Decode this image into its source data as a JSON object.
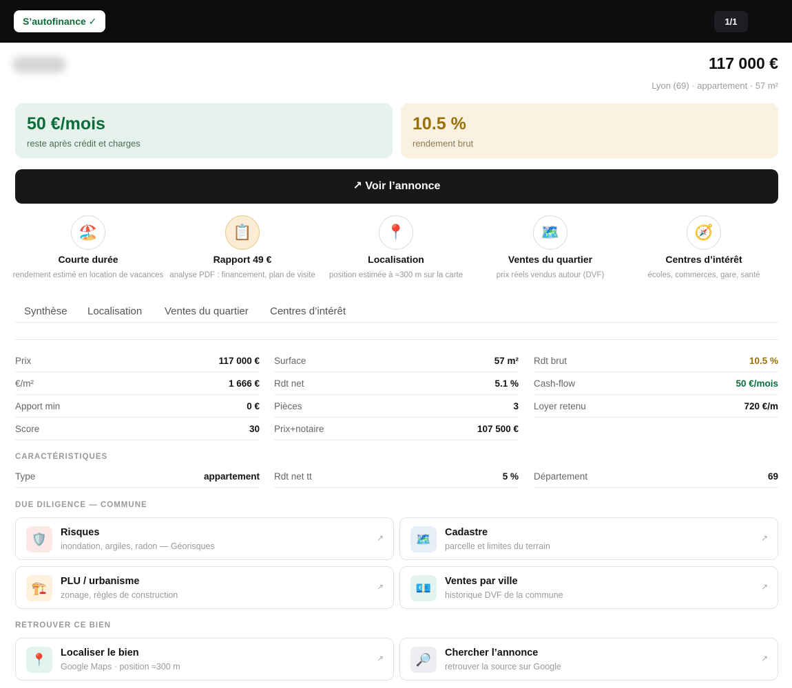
{
  "topbar": {
    "badge": "S’autofinance ✓",
    "counter": "1/1"
  },
  "header": {
    "price": "117 000 €",
    "location": "Lyon (69) · appartement · 57 m²"
  },
  "kpis": {
    "cashflow": {
      "value": "50 €/mois",
      "label": "reste après crédit et charges"
    },
    "yield": {
      "value": "10.5 %",
      "label": "rendement brut"
    }
  },
  "cta": {
    "label": "↗ Voir l’annonce"
  },
  "features": [
    {
      "icon": "🏖️",
      "icon_name": "beach-umbrella-icon",
      "title": "Courte durée",
      "subtitle": "rendement estimé en location de vacances"
    },
    {
      "icon": "📋",
      "icon_name": "clipboard-icon",
      "title": "Rapport 49 €",
      "subtitle": "analyse PDF : financement, plan de visite"
    },
    {
      "icon": "📍",
      "icon_name": "map-pin-icon",
      "title": "Localisation",
      "subtitle": "position estimée à ≈300 m sur la carte"
    },
    {
      "icon": "🗺️",
      "icon_name": "map-icon",
      "title": "Ventes du quartier",
      "subtitle": "prix réels vendus autour (DVF)"
    },
    {
      "icon": "🧭",
      "icon_name": "compass-icon",
      "title": "Centres d’intérêt",
      "subtitle": "écoles, commerces, gare, santé"
    }
  ],
  "tabs": [
    "Synthèse",
    "Localisation",
    "Ventes du quartier",
    "Centres d’intérêt"
  ],
  "stats": {
    "col1": [
      {
        "label": "Prix",
        "value": "117 000 €"
      },
      {
        "label": "€/m²",
        "value": "1 666 €"
      },
      {
        "label": "Apport min",
        "value": "0 €"
      },
      {
        "label": "Score",
        "value": "30"
      }
    ],
    "col2": [
      {
        "label": "Surface",
        "value": "57 m²"
      },
      {
        "label": "Rdt net",
        "value": "5.1 %"
      },
      {
        "label": "Pièces",
        "value": "3"
      },
      {
        "label": "Prix+notaire",
        "value": "107 500 €"
      }
    ],
    "col3": [
      {
        "label": "Rdt brut",
        "value": "10.5 %"
      },
      {
        "label": "Cash-flow",
        "value": "50 €/mois"
      },
      {
        "label": "Loyer retenu",
        "value": "720 €/m"
      }
    ]
  },
  "characteristics": {
    "heading": "CARACTÉRISTIQUES",
    "rows": [
      {
        "label": "Type",
        "value": "appartement"
      },
      {
        "label": "Rdt net tt",
        "value": "5 %"
      },
      {
        "label": "Département",
        "value": "69"
      }
    ]
  },
  "due_diligence": {
    "heading": "DUE DILIGENCE — COMMUNE",
    "cards": [
      {
        "icon": "🛡️",
        "icon_name": "shield-icon",
        "title": "Risques",
        "subtitle": "inondation, argiles, radon — Géorisques"
      },
      {
        "icon": "🗺️",
        "icon_name": "map-icon",
        "title": "Cadastre",
        "subtitle": "parcelle et limites du terrain"
      },
      {
        "icon": "🏗️",
        "icon_name": "crane-icon",
        "title": "PLU / urbanisme",
        "subtitle": "zonage, règles de construction"
      },
      {
        "icon": "💶",
        "icon_name": "euro-banknote-icon",
        "title": "Ventes par ville",
        "subtitle": "historique DVF de la commune"
      }
    ]
  },
  "find": {
    "heading": "RETROUVER CE BIEN",
    "cards": [
      {
        "icon": "📍",
        "icon_name": "map-pin-icon",
        "title": "Localiser le bien",
        "subtitle": "Google Maps · position ≈300 m"
      },
      {
        "icon": "🔎",
        "icon_name": "magnifier-icon",
        "title": "Chercher l’annonce",
        "subtitle": "retrouver la source sur Google"
      }
    ]
  },
  "colors": {
    "green": "#0d6b3c",
    "gold": "#9a6f08",
    "dark": "#0d0d0f"
  }
}
